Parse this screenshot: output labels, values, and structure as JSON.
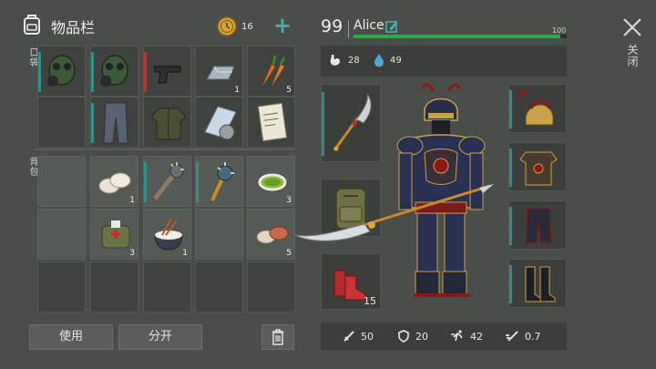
{
  "header": {
    "title": "物品栏",
    "coin_count": "16",
    "add_symbol": "+"
  },
  "sections": {
    "pockets_label": "口袋",
    "backpack_label": "背包"
  },
  "player": {
    "level": "99",
    "name": "Alice",
    "health_max": "100",
    "health_fraction": 0.97,
    "hunger": "28",
    "thirst": "49"
  },
  "close": {
    "label": "关闭"
  },
  "slots": {
    "pocket": [
      {
        "item": "gas-mask",
        "count": "",
        "bar": "#2f8f8a"
      },
      {
        "item": "gas-mask",
        "count": "",
        "bar": "#2f8f8a"
      },
      {
        "item": "pistol",
        "count": "",
        "bar": "#b43a2e"
      },
      {
        "item": "iron-ingot",
        "count": "1",
        "bar": ""
      },
      {
        "item": "carrots",
        "count": "5",
        "bar": ""
      },
      {
        "item": "empty",
        "count": "",
        "bar": ""
      },
      {
        "item": "pants",
        "count": "",
        "bar": "#2f8f8a"
      },
      {
        "item": "jacket",
        "count": "",
        "bar": ""
      },
      {
        "item": "map-compass",
        "count": "",
        "bar": ""
      },
      {
        "item": "note",
        "count": "",
        "bar": ""
      }
    ],
    "backpack": [
      {
        "item": "empty",
        "count": "",
        "bar": ""
      },
      {
        "item": "dumplings",
        "count": "1",
        "bar": ""
      },
      {
        "item": "spiked-club",
        "count": "",
        "bar": "#2f8f8a"
      },
      {
        "item": "spiked-mace",
        "count": "",
        "bar": "#2f8f8a"
      },
      {
        "item": "green-tea",
        "count": "3",
        "bar": ""
      },
      {
        "item": "empty",
        "count": "",
        "bar": ""
      },
      {
        "item": "medkit-bag",
        "count": "3",
        "bar": ""
      },
      {
        "item": "rice-bowl",
        "count": "1",
        "bar": ""
      },
      {
        "item": "empty",
        "count": "",
        "bar": ""
      },
      {
        "item": "rolls",
        "count": "5",
        "bar": ""
      }
    ]
  },
  "equipment": {
    "weapon": "guan-dao",
    "backpack": "military-backpack",
    "boots_count": "15"
  },
  "buttons": {
    "use": "使用",
    "split": "分开"
  },
  "stats": {
    "attack": "50",
    "defense": "20",
    "speed": "42",
    "attack_speed": "0.7"
  },
  "colors": {
    "accent_green": "#2fa84a",
    "teal": "#2f8f8a",
    "red": "#b43a2e"
  }
}
